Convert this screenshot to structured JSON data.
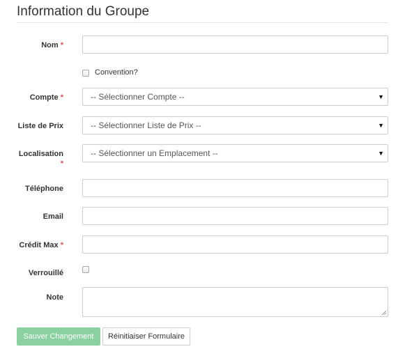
{
  "header": {
    "title": "Information du Groupe"
  },
  "required_marker": "*",
  "fields": {
    "nom": {
      "label": "Nom",
      "value": ""
    },
    "convention": {
      "label": "Convention?",
      "checked": false
    },
    "compte": {
      "label": "Compte",
      "selected": "-- Sélectionner Compte --"
    },
    "liste_prix": {
      "label": "Liste de Prix",
      "selected": "-- Sélectionner Liste de Prix --"
    },
    "localisation": {
      "label": "Localisation",
      "selected": "-- Sélectionner un Emplacement --"
    },
    "telephone": {
      "label": "Téléphone",
      "value": ""
    },
    "email": {
      "label": "Email",
      "value": ""
    },
    "credit_max": {
      "label": "Crédit Max",
      "value": ""
    },
    "verrouille": {
      "label": "Verrouillé",
      "checked": false
    },
    "note": {
      "label": "Note",
      "value": ""
    }
  },
  "icons": {
    "select_arrow": "▼"
  },
  "buttons": {
    "save_label": "Sauver Changement",
    "reset_label": "Réinitiaiser Formulaire"
  },
  "colors": {
    "save_button": "#8bd0a0",
    "required": "#d9534f"
  }
}
